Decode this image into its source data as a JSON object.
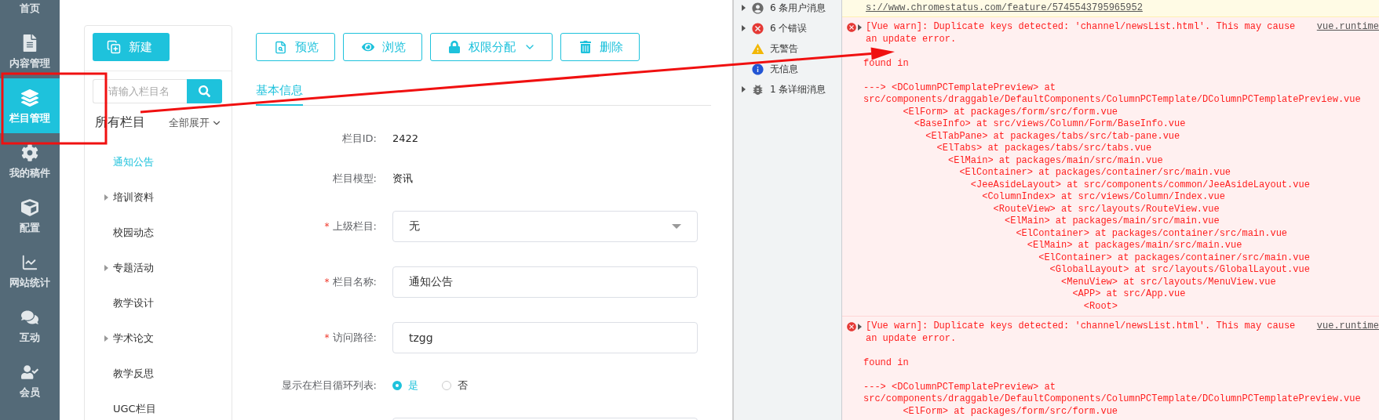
{
  "nav": [
    {
      "label": "首页",
      "selected": false
    },
    {
      "label": "内容管理",
      "selected": false
    },
    {
      "label": "栏目管理",
      "selected": true
    },
    {
      "label": "我的稿件",
      "selected": false
    },
    {
      "label": "配置",
      "selected": false
    },
    {
      "label": "网站统计",
      "selected": false
    },
    {
      "label": "互动",
      "selected": false
    },
    {
      "label": "会员",
      "selected": false
    }
  ],
  "tree_panel": {
    "new_button": "新建",
    "search": {
      "placeholder": "请输入栏目名"
    },
    "title": "所有栏目",
    "expand_all": "全部展开",
    "items": [
      {
        "label": "通知公告",
        "expandable": false,
        "selected": true
      },
      {
        "label": "培训资料",
        "expandable": true,
        "selected": false
      },
      {
        "label": "校园动态",
        "expandable": false,
        "selected": false
      },
      {
        "label": "专题活动",
        "expandable": true,
        "selected": false
      },
      {
        "label": "教学设计",
        "expandable": false,
        "selected": false
      },
      {
        "label": "学术论文",
        "expandable": true,
        "selected": false
      },
      {
        "label": "教学反思",
        "expandable": false,
        "selected": false
      },
      {
        "label": "UGC栏目",
        "expandable": false,
        "selected": false
      }
    ]
  },
  "toolbar": [
    {
      "label": "预览",
      "has_menu": false
    },
    {
      "label": "浏览",
      "has_menu": false
    },
    {
      "label": "权限分配",
      "has_menu": true
    },
    {
      "label": "删除",
      "has_menu": false
    }
  ],
  "tabs": [
    {
      "label": "基本信息",
      "selected": true
    }
  ],
  "form": [
    {
      "kind": "static",
      "label": "栏目ID:",
      "value": "2422"
    },
    {
      "kind": "static",
      "label": "栏目模型:",
      "value": "资讯"
    },
    {
      "kind": "select",
      "label": "上级栏目:",
      "value": "无",
      "required_mark": "*"
    },
    {
      "kind": "input",
      "label": "栏目名称:",
      "value": "通知公告",
      "required_mark": "*"
    },
    {
      "kind": "input",
      "label": "访问路径:",
      "value": "tzgg",
      "required_mark": "*"
    },
    {
      "kind": "radio",
      "label": "显示在栏目循环列表:",
      "options": [
        {
          "label": "是",
          "selected": true
        },
        {
          "label": "否",
          "selected": false
        }
      ]
    },
    {
      "kind": "input"
    }
  ],
  "console_sidebar": [
    {
      "label": "6 条用户消息",
      "expandable": true
    },
    {
      "label": "6 个错误",
      "expandable": true
    },
    {
      "label": "无警告",
      "expandable": false
    },
    {
      "label": "无信息",
      "expandable": false
    },
    {
      "label": "1 条详细消息",
      "expandable": true
    }
  ],
  "console": {
    "notice_link": "s://www.chromestatus.com/feature/5745543795965952",
    "messages": [
      {
        "text": "[Vue warn]: Duplicate keys detected: 'channel/newsList.html'. This may cause an update error.",
        "source": "vue.runtime",
        "found_label": "found in",
        "stack": [
          "---> <DColumnPCTemplatePreview> at src/components/draggable/DefaultComponents/ColumnPCTemplate/DColumnPCTemplatePreview.vue",
          "<ElForm> at packages/form/src/form.vue",
          "<BaseInfo> at src/views/Column/Form/BaseInfo.vue",
          "<ElTabPane> at packages/tabs/src/tab-pane.vue",
          "<ElTabs> at packages/tabs/src/tabs.vue",
          "<ElMain> at packages/main/src/main.vue",
          "<ElContainer> at packages/container/src/main.vue",
          "<JeeAsideLayout> at src/components/common/JeeAsideLayout.vue",
          "<ColumnIndex> at src/views/Column/Index.vue",
          "<RouteView> at src/layouts/RouteView.vue",
          "<ElMain> at packages/main/src/main.vue",
          "<ElContainer> at packages/container/src/main.vue",
          "<ElMain> at packages/main/src/main.vue",
          "<ElContainer> at packages/container/src/main.vue",
          "<GlobalLayout> at src/layouts/GlobalLayout.vue",
          "<MenuView> at src/layouts/MenuView.vue",
          "<APP> at src/App.vue",
          "<Root>"
        ]
      },
      {
        "text": "[Vue warn]: Duplicate keys detected: 'channel/newsList.html'. This may cause an update error.",
        "source": "vue.runtime",
        "found_label": "found in",
        "stack": [
          "---> <DColumnPCTemplatePreview> at src/components/draggable/DefaultComponents/ColumnPCTemplate/DColumnPCTemplatePreview.vue",
          "<ElForm> at packages/form/src/form.vue"
        ]
      }
    ]
  }
}
